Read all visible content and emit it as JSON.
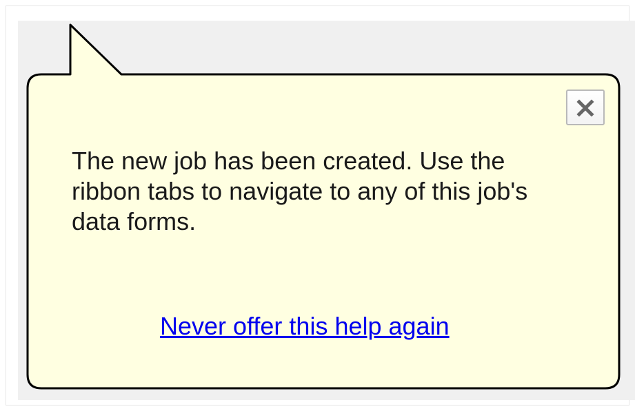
{
  "balloon": {
    "message": "The new job has been created. Use the ribbon tabs to navigate to any of this job's data forms.",
    "link_label": "Never offer this help again",
    "close_icon": "close-icon",
    "colors": {
      "background": "#ffffe1",
      "border": "#000000",
      "link": "#0000ee",
      "backdrop": "#f0f0f0"
    }
  }
}
